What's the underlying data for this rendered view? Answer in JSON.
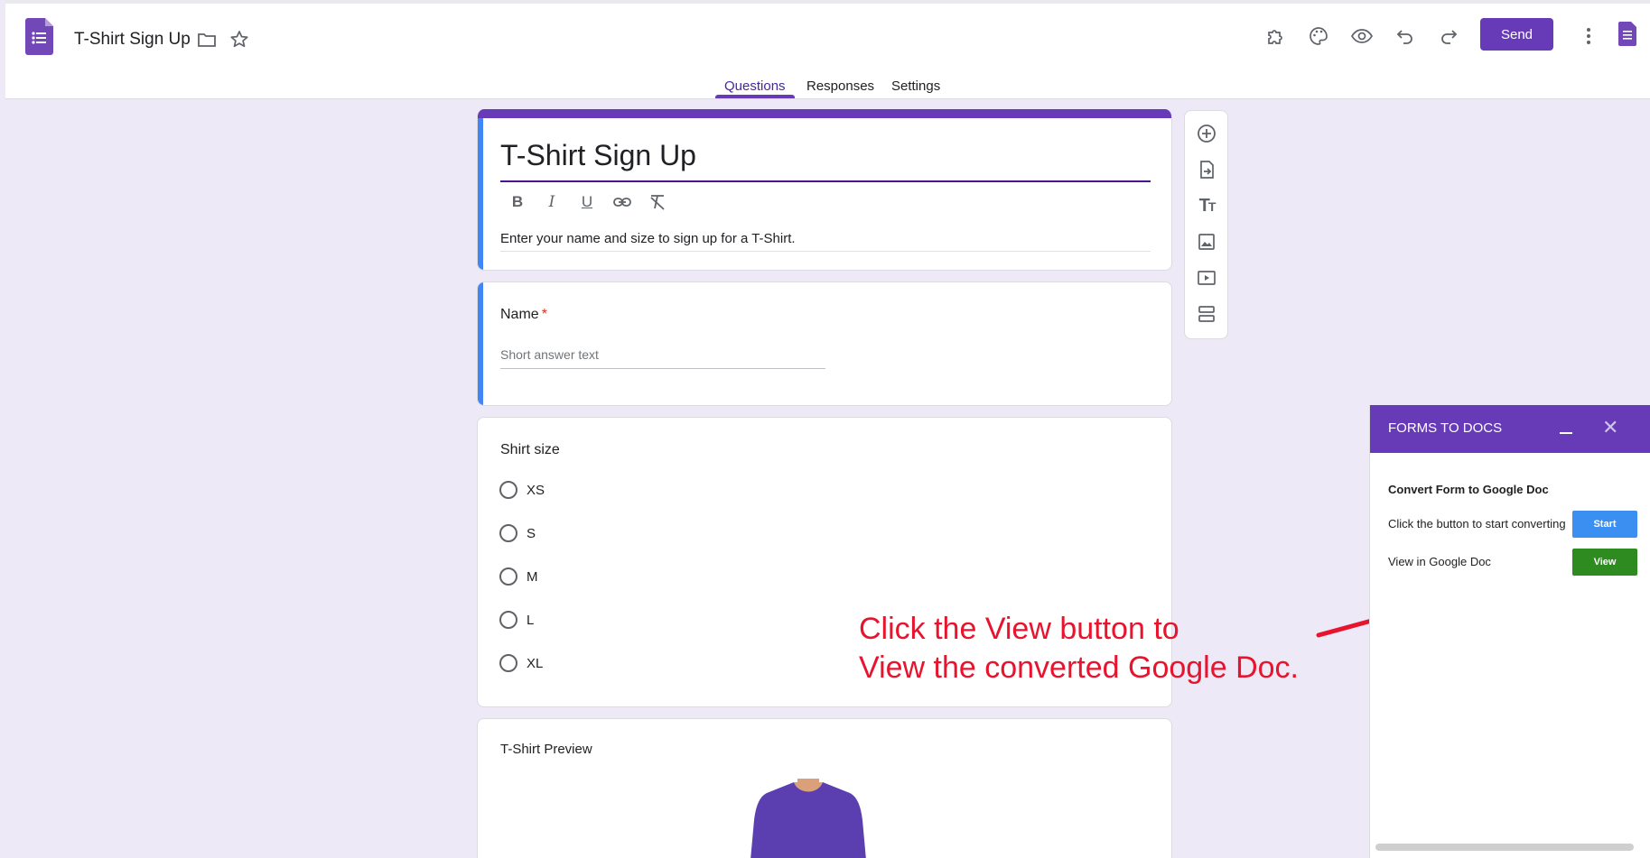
{
  "header": {
    "doc_title": "T-Shirt Sign Up",
    "send_label": "Send",
    "tabs": [
      {
        "label": "Questions"
      },
      {
        "label": "Responses"
      },
      {
        "label": "Settings"
      }
    ]
  },
  "form": {
    "title": "T-Shirt Sign Up",
    "description": "Enter your name and size to sign up for a T-Shirt.",
    "questions": [
      {
        "label": "Name",
        "required_mark": "*",
        "placeholder": "Short answer text"
      },
      {
        "label": "Shirt size",
        "options": [
          "XS",
          "S",
          "M",
          "L",
          "XL"
        ]
      },
      {
        "label": "T-Shirt Preview"
      }
    ]
  },
  "addon": {
    "title": "FORMS TO DOCS",
    "heading": "Convert Form to Google Doc",
    "start_text": "Click the button to start converting",
    "start_label": "Start",
    "view_text": "View in Google Doc",
    "view_label": "View"
  },
  "annotation": {
    "line1": "Click the View button to",
    "line2": "View the converted Google Doc."
  },
  "colors": {
    "accent": "#673ab7",
    "start_button": "#3b8ff0",
    "view_button": "#2e8b1f",
    "annotation": "#e8132d"
  }
}
